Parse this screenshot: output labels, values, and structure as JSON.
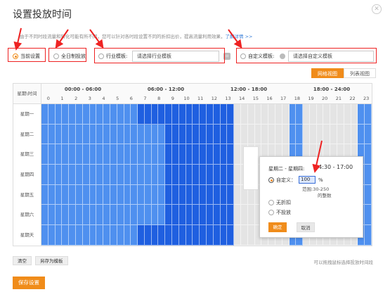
{
  "title": "设置投放时间",
  "notice": {
    "text": "由于不同时段流量和转化可能有所不同，您可以针对各时段设置不同的折扣出价，提高流量利用效果，",
    "link": "了解详情 >>"
  },
  "options": {
    "current": "当前设置",
    "allday": "全日制投放",
    "industry_label": "行业模板:",
    "industry_placeholder": "请选择行业模板",
    "custom_label": "自定义模板:",
    "custom_placeholder": "请选择自定义模板"
  },
  "views": {
    "grid": "网格视图",
    "list": "列表视图"
  },
  "grid": {
    "corner": "星期\\时间",
    "periods": [
      "00:00 - 06:00",
      "06:00 - 12:00",
      "12:00 - 18:00",
      "18:00 - 24:00"
    ],
    "hours": [
      "0",
      "1",
      "2",
      "3",
      "4",
      "5",
      "6",
      "7",
      "8",
      "9",
      "10",
      "11",
      "12",
      "13",
      "14",
      "15",
      "16",
      "17",
      "18",
      "19",
      "20",
      "21",
      "22",
      "23"
    ],
    "days": [
      "星期一",
      "星期二",
      "星期三",
      "星期四",
      "星期五",
      "星期六",
      "星期天"
    ]
  },
  "popup": {
    "range": "星期二 - 星期四:",
    "time": "14:30 - 17:00",
    "custom_label": "自定义：",
    "custom_value": "100",
    "percent": "%",
    "hint1": "范围:30-250",
    "hint2": "的整数",
    "no_discount": "无折扣",
    "no_serve": "不投放",
    "ok": "确定",
    "cancel": "取消"
  },
  "bottom": {
    "clear": "清空",
    "save_template": "另存为模板",
    "hint": "可以拖拽鼠标选择投放时间段",
    "save": "保存设置"
  },
  "colors": {
    "accent": "#f08c1a",
    "cell_light": "#4f90ef",
    "cell_dark": "#1f5fe0",
    "cell_gray": "#e4e4e4",
    "annotation": "#e22"
  }
}
